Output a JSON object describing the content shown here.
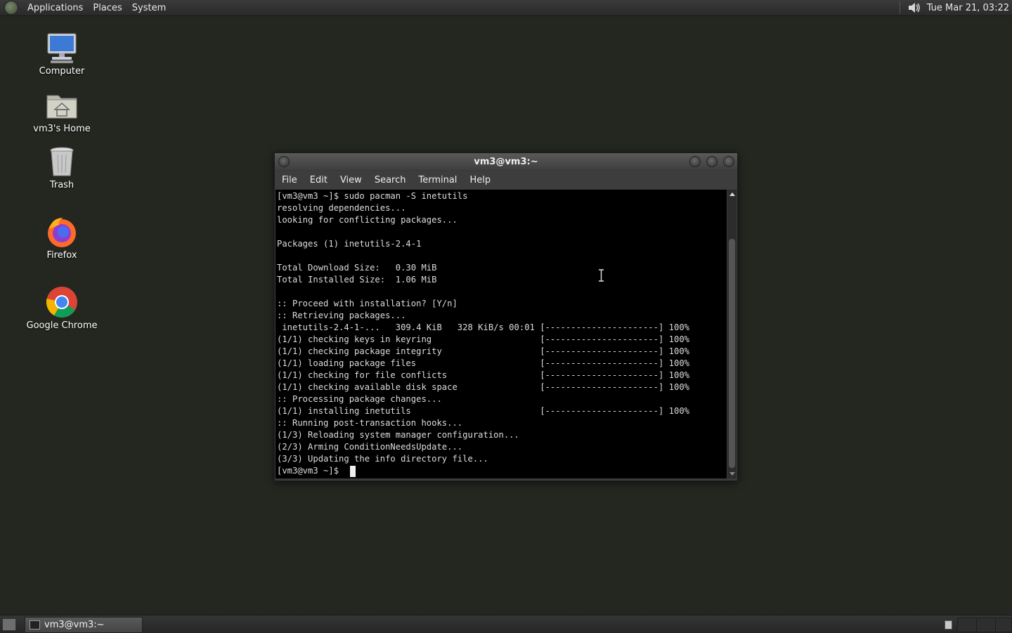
{
  "top_panel": {
    "menus": [
      "Applications",
      "Places",
      "System"
    ],
    "clock": "Tue Mar 21, 03:22",
    "icons": [
      "gnome-foot-icon",
      "speaker-icon"
    ]
  },
  "desktop": {
    "icons": [
      {
        "label": "Computer",
        "icon": "computer-icon"
      },
      {
        "label": "vm3's Home",
        "icon": "home-folder-icon"
      },
      {
        "label": "Trash",
        "icon": "trash-icon"
      },
      {
        "label": "Firefox",
        "icon": "firefox-icon"
      },
      {
        "label": "Google Chrome",
        "icon": "chrome-icon"
      }
    ]
  },
  "terminal": {
    "title": "vm3@vm3:~",
    "menu": [
      "File",
      "Edit",
      "View",
      "Search",
      "Terminal",
      "Help"
    ],
    "lines": [
      "[vm3@vm3 ~]$ sudo pacman -S inetutils",
      "resolving dependencies...",
      "looking for conflicting packages...",
      "",
      "Packages (1) inetutils-2.4-1",
      "",
      "Total Download Size:   0.30 MiB",
      "Total Installed Size:  1.06 MiB",
      "",
      ":: Proceed with installation? [Y/n]",
      ":: Retrieving packages...",
      " inetutils-2.4-1-...   309.4 KiB   328 KiB/s 00:01 [----------------------] 100%",
      "(1/1) checking keys in keyring                     [----------------------] 100%",
      "(1/1) checking package integrity                   [----------------------] 100%",
      "(1/1) loading package files                        [----------------------] 100%",
      "(1/1) checking for file conflicts                  [----------------------] 100%",
      "(1/1) checking available disk space                [----------------------] 100%",
      ":: Processing package changes...",
      "(1/1) installing inetutils                         [----------------------] 100%",
      ":: Running post-transaction hooks...",
      "(1/3) Reloading system manager configuration...",
      "(2/3) Arming ConditionNeedsUpdate...",
      "(3/3) Updating the info directory file...",
      "[vm3@vm3 ~]$ "
    ]
  },
  "bottom_panel": {
    "task_label": "vm3@vm3:~"
  },
  "colors": {
    "desktop_bg": "#232720",
    "terminal_bg": "#000000",
    "terminal_fg": "#dcdcdc"
  }
}
